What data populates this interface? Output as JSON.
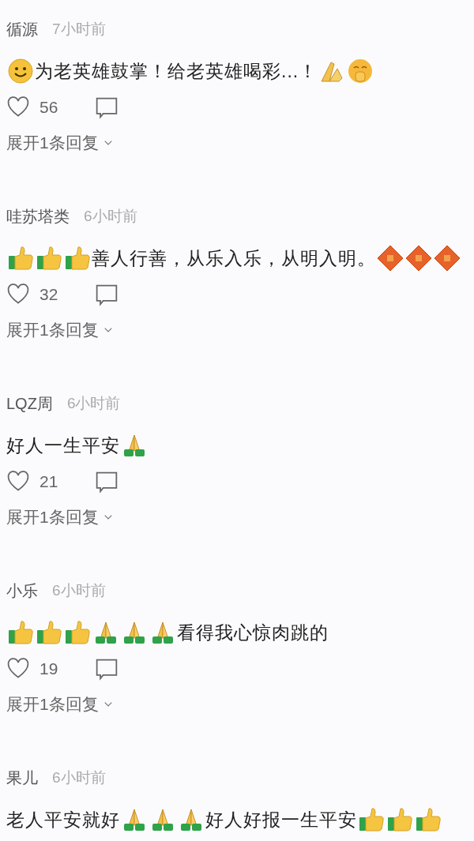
{
  "comments": [
    {
      "user": "循源",
      "time": "7小时前",
      "content": [
        {
          "kind": "smile"
        },
        {
          "kind": "text",
          "text": "为老英雄鼓掌！给老英雄喝彩...！"
        },
        {
          "kind": "pray-yellow"
        },
        {
          "kind": "shy"
        }
      ],
      "likes": "56",
      "replies": "展开1条回复"
    },
    {
      "user": "哇苏塔类",
      "time": "6小时前",
      "content": [
        {
          "kind": "thumbs-up"
        },
        {
          "kind": "thumbs-up"
        },
        {
          "kind": "thumbs-up"
        },
        {
          "kind": "text",
          "text": "善人行善，从乐入乐，从明入明。"
        },
        {
          "kind": "fu"
        },
        {
          "kind": "fu"
        },
        {
          "kind": "fu"
        }
      ],
      "likes": "32",
      "replies": "展开1条回复"
    },
    {
      "user": "LQZ周",
      "time": "6小时前",
      "content": [
        {
          "kind": "text",
          "text": "好人一生平安"
        },
        {
          "kind": "pray"
        }
      ],
      "likes": "21",
      "replies": "展开1条回复"
    },
    {
      "user": "小乐",
      "time": "6小时前",
      "content": [
        {
          "kind": "thumbs-up"
        },
        {
          "kind": "thumbs-up"
        },
        {
          "kind": "thumbs-up"
        },
        {
          "kind": "pray"
        },
        {
          "kind": "pray"
        },
        {
          "kind": "pray"
        },
        {
          "kind": "text",
          "text": "看得我心惊肉跳的"
        }
      ],
      "likes": "19",
      "replies": "展开1条回复"
    },
    {
      "user": "果儿",
      "time": "6小时前",
      "content": [
        {
          "kind": "text",
          "text": "老人平安就好"
        },
        {
          "kind": "pray"
        },
        {
          "kind": "pray"
        },
        {
          "kind": "pray"
        },
        {
          "kind": "text",
          "text": "好人好报一生平安"
        },
        {
          "kind": "thumbs-up"
        },
        {
          "kind": "thumbs-up"
        },
        {
          "kind": "thumbs-up"
        }
      ]
    }
  ]
}
